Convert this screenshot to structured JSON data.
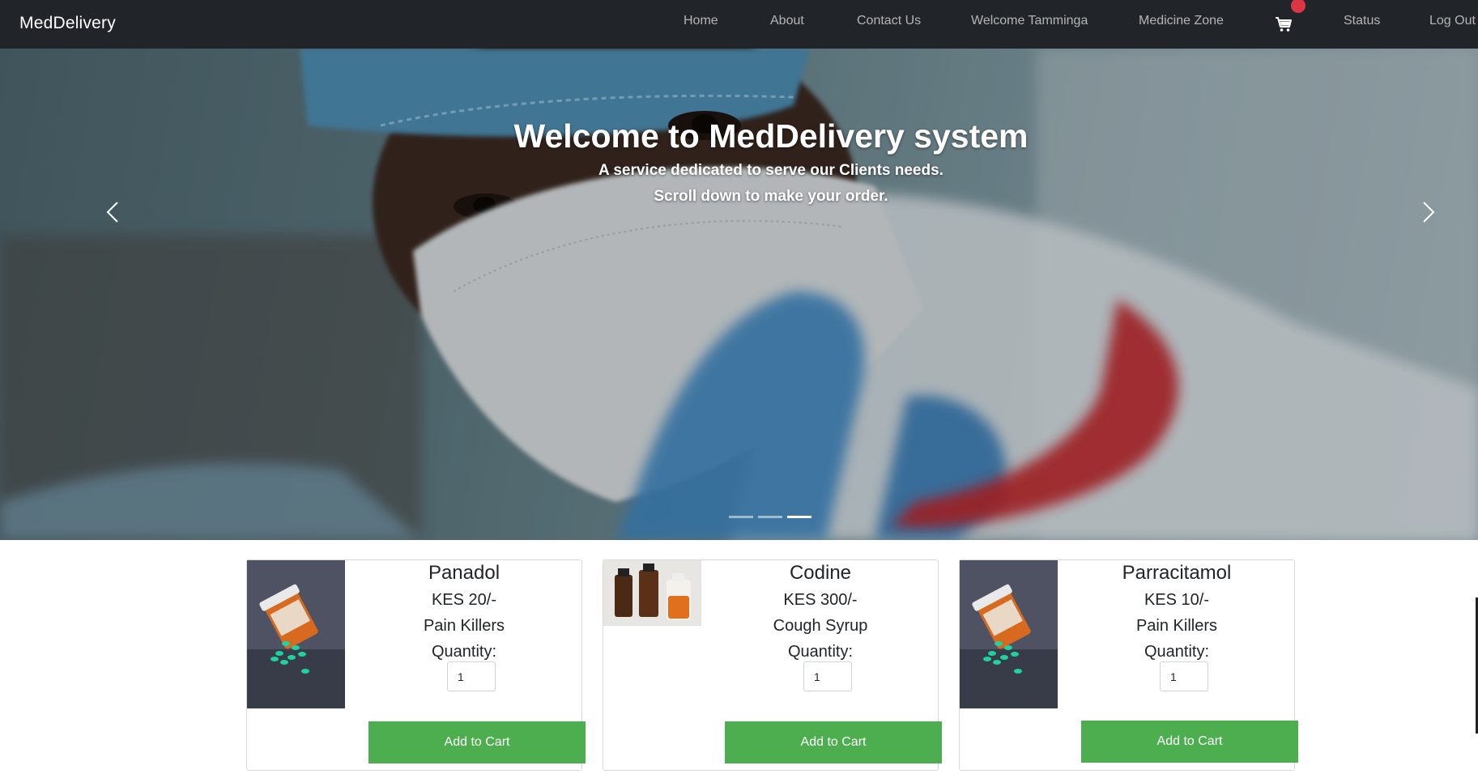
{
  "navbar": {
    "brand": "MedDelivery",
    "links": [
      {
        "label": "Home"
      },
      {
        "label": "About"
      },
      {
        "label": "Contact Us"
      },
      {
        "label": "Welcome Tamminga"
      },
      {
        "label": "Medicine Zone"
      },
      {
        "label": "Status"
      },
      {
        "label": "Log Out"
      }
    ],
    "cart_icon": "cart-icon",
    "cart_badge_color": "#dc3545"
  },
  "hero": {
    "title": "Welcome to MedDelivery system",
    "subtitle_line1": "A service dedicated to serve our Clients needs.",
    "subtitle_line2": "Scroll down to make your order.",
    "prev_icon": "chevron-left-icon",
    "next_icon": "chevron-right-icon",
    "slide_count": 3,
    "active_slide": 3
  },
  "products": [
    {
      "name": "Panadol",
      "price": "KES 20/-",
      "category": "Pain Killers",
      "quantity_label": "Quantity:",
      "quantity": "1",
      "button_label": "Add to Cart",
      "image": "pill-bottle-image"
    },
    {
      "name": "Codine",
      "price": "KES 300/-",
      "category": "Cough Syrup",
      "quantity_label": "Quantity:",
      "quantity": "1",
      "button_label": "Add to Cart",
      "image": "syrup-bottles-image"
    },
    {
      "name": "Parracitamol",
      "price": "KES 10/-",
      "category": "Pain Killers",
      "quantity_label": "Quantity:",
      "quantity": "1",
      "button_label": "Add to Cart",
      "image": "pill-bottle-image"
    }
  ],
  "colors": {
    "navbar_bg": "#212529",
    "button_green": "#4cae4f"
  }
}
